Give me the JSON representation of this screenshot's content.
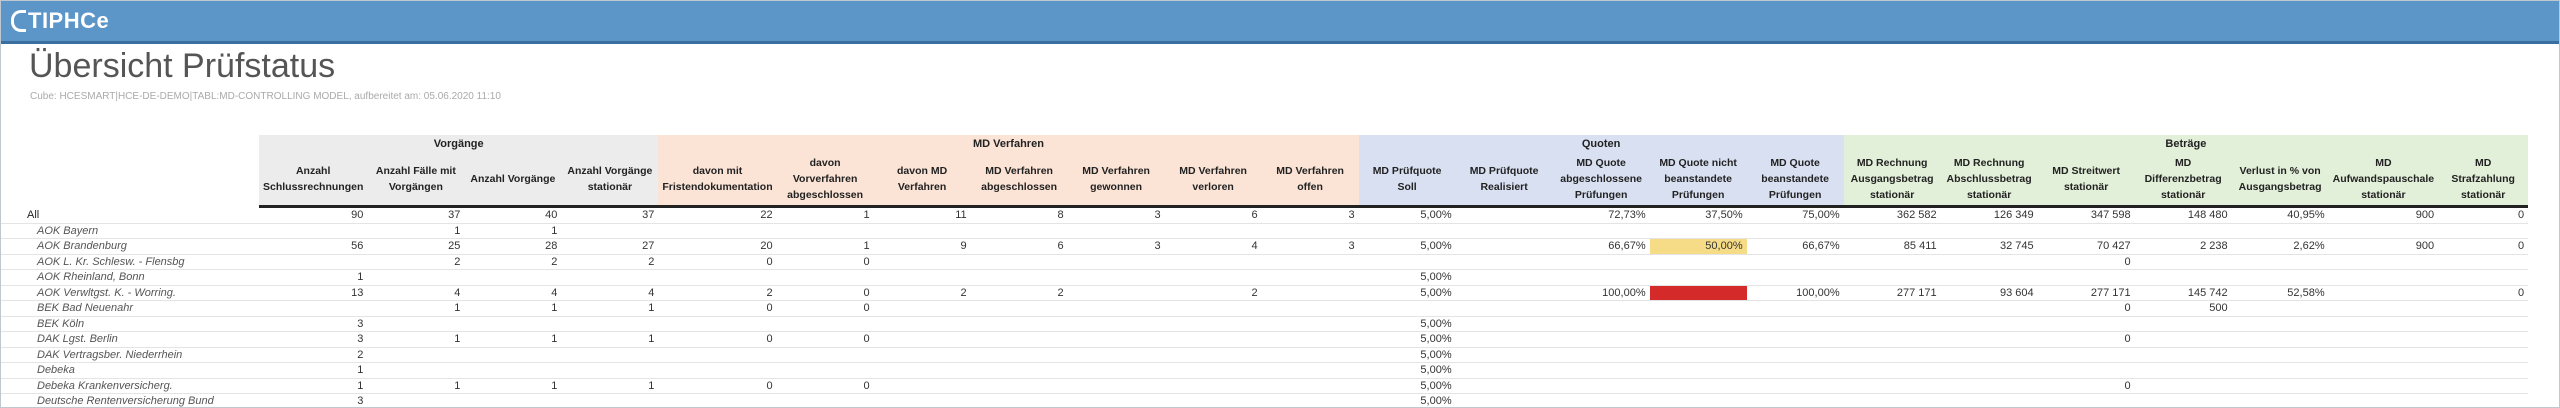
{
  "app": {
    "logo_text": "TIPHCe"
  },
  "page": {
    "title": "Übersicht Prüfstatus",
    "subtitle": "Cube: HCESMART|HCE-DE-DEMO|TABL:MD-CONTROLLING MODEL, aufbereitet am: 05.06.2020 11:10"
  },
  "groups": [
    {
      "label": "",
      "span": 1,
      "tone": "none"
    },
    {
      "label": "Vorgänge",
      "span": 4,
      "tone": "gray"
    },
    {
      "label": "MD Verfahren",
      "span": 7,
      "tone": "orange"
    },
    {
      "label": "Quoten",
      "span": 5,
      "tone": "blue"
    },
    {
      "label": "Beträge",
      "span": 7,
      "tone": "green"
    }
  ],
  "columns": [
    {
      "label": "",
      "tone": "none"
    },
    {
      "label": "Anzahl Schlussrechnungen",
      "tone": "gray"
    },
    {
      "label": "Anzahl Fälle mit Vorgängen",
      "tone": "gray"
    },
    {
      "label": "Anzahl Vorgänge",
      "tone": "gray"
    },
    {
      "label": "Anzahl Vorgänge stationär",
      "tone": "gray"
    },
    {
      "label": "davon mit Fristendokumentation",
      "tone": "orange"
    },
    {
      "label": "davon Vorverfahren abgeschlossen",
      "tone": "orange"
    },
    {
      "label": "davon MD Verfahren",
      "tone": "orange"
    },
    {
      "label": "MD Verfahren abgeschlossen",
      "tone": "orange"
    },
    {
      "label": "MD Verfahren gewonnen",
      "tone": "orange"
    },
    {
      "label": "MD Verfahren verloren",
      "tone": "orange"
    },
    {
      "label": "MD Verfahren offen",
      "tone": "orange"
    },
    {
      "label": "MD Prüfquote Soll",
      "tone": "blue"
    },
    {
      "label": "MD Prüfquote Realisiert",
      "tone": "blue"
    },
    {
      "label": "MD Quote abgeschlossene Prüfungen",
      "tone": "blue"
    },
    {
      "label": "MD Quote nicht beanstandete Prüfungen",
      "tone": "blue"
    },
    {
      "label": "MD Quote beanstandete Prüfungen",
      "tone": "blue"
    },
    {
      "label": "MD Rechnung Ausgangsbetrag stationär",
      "tone": "green"
    },
    {
      "label": "MD Rechnung Abschlussbetrag stationär",
      "tone": "green"
    },
    {
      "label": "MD Streitwert stationär",
      "tone": "green"
    },
    {
      "label": "MD Differenzbetrag stationär",
      "tone": "green"
    },
    {
      "label": "Verlust in % von Ausgangsbetrag",
      "tone": "green"
    },
    {
      "label": "MD Aufwandspauschale stationär",
      "tone": "green"
    },
    {
      "label": "MD Strafzahlung stationär",
      "tone": "green"
    }
  ],
  "rows": [
    {
      "name": "All",
      "cells": [
        "90",
        "37",
        "40",
        "37",
        "22",
        "1",
        "11",
        "8",
        "3",
        "6",
        "3",
        "5,00%",
        "",
        "72,73%",
        "37,50%",
        "75,00%",
        "362 582",
        "126 349",
        "347 598",
        "148 480",
        "40,95%",
        "900",
        "0"
      ]
    },
    {
      "name": "AOK Bayern",
      "cells": [
        "",
        "1",
        "1",
        "",
        "",
        "",
        "",
        "",
        "",
        "",
        "",
        "",
        "",
        "",
        "",
        "",
        "",
        "",
        "",
        "",
        "",
        "",
        ""
      ]
    },
    {
      "name": "AOK Brandenburg",
      "cells": [
        "56",
        "25",
        "28",
        "27",
        "20",
        "1",
        "9",
        "6",
        "3",
        "4",
        "3",
        "5,00%",
        "",
        "66,67%",
        "50,00%",
        "66,67%",
        "85 411",
        "32 745",
        "70 427",
        "2 238",
        "2,62%",
        "900",
        "0"
      ]
    },
    {
      "name": "AOK L. Kr. Schlesw. - Flensbg",
      "cells": [
        "",
        "2",
        "2",
        "2",
        "0",
        "0",
        "",
        "",
        "",
        "",
        "",
        "",
        "",
        "",
        "",
        "",
        "",
        "",
        "0",
        "",
        "",
        "",
        ""
      ]
    },
    {
      "name": "AOK Rheinland, Bonn",
      "cells": [
        "1",
        "",
        "",
        "",
        "",
        "",
        "",
        "",
        "",
        "",
        "",
        "5,00%",
        "",
        "",
        "",
        "",
        "",
        "",
        "",
        "",
        "",
        "",
        ""
      ]
    },
    {
      "name": "AOK Verwltgst. K. - Worring.",
      "cells": [
        "13",
        "4",
        "4",
        "4",
        "2",
        "0",
        "2",
        "2",
        "",
        "2",
        "",
        "5,00%",
        "",
        "100,00%",
        "",
        "100,00%",
        "277 171",
        "93 604",
        "277 171",
        "145 742",
        "52,58%",
        "",
        "0"
      ]
    },
    {
      "name": "BEK Bad Neuenahr",
      "cells": [
        "",
        "1",
        "1",
        "1",
        "0",
        "0",
        "",
        "",
        "",
        "",
        "",
        "",
        "",
        "",
        "",
        "",
        "",
        "",
        "0",
        "500",
        "",
        "",
        ""
      ]
    },
    {
      "name": "BEK Köln",
      "cells": [
        "3",
        "",
        "",
        "",
        "",
        "",
        "",
        "",
        "",
        "",
        "",
        "5,00%",
        "",
        "",
        "",
        "",
        "",
        "",
        "",
        "",
        "",
        "",
        ""
      ]
    },
    {
      "name": "DAK Lgst. Berlin",
      "cells": [
        "3",
        "1",
        "1",
        "1",
        "0",
        "0",
        "",
        "",
        "",
        "",
        "",
        "5,00%",
        "",
        "",
        "",
        "",
        "",
        "",
        "0",
        "",
        "",
        "",
        ""
      ]
    },
    {
      "name": "DAK Vertragsber. Niederrhein",
      "cells": [
        "2",
        "",
        "",
        "",
        "",
        "",
        "",
        "",
        "",
        "",
        "",
        "5,00%",
        "",
        "",
        "",
        "",
        "",
        "",
        "",
        "",
        "",
        "",
        ""
      ]
    },
    {
      "name": "Debeka",
      "cells": [
        "1",
        "",
        "",
        "",
        "",
        "",
        "",
        "",
        "",
        "",
        "",
        "5,00%",
        "",
        "",
        "",
        "",
        "",
        "",
        "",
        "",
        "",
        "",
        ""
      ]
    },
    {
      "name": "Debeka Krankenversicherg.",
      "cells": [
        "1",
        "1",
        "1",
        "1",
        "0",
        "0",
        "",
        "",
        "",
        "",
        "",
        "5,00%",
        "",
        "",
        "",
        "",
        "",
        "",
        "0",
        "",
        "",
        "",
        ""
      ]
    },
    {
      "name": "Deutsche Rentenversicherung Bund",
      "cells": [
        "3",
        "",
        "",
        "",
        "",
        "",
        "",
        "",
        "",
        "",
        "",
        "5,00%",
        "",
        "",
        "",
        "",
        "",
        "",
        "",
        "",
        "",
        "",
        ""
      ]
    }
  ],
  "highlights": [
    {
      "row": 2,
      "col": 14,
      "color": "#f6dc86"
    },
    {
      "row": 5,
      "col": 14,
      "color": "#d42a2a"
    }
  ]
}
